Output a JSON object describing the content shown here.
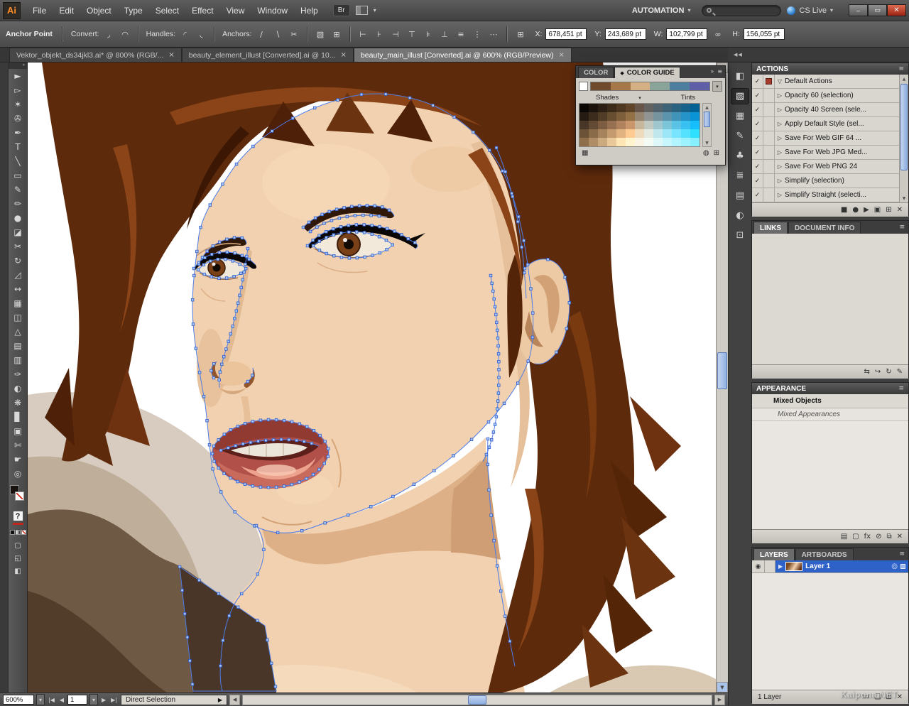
{
  "menubar": {
    "logo": "Ai",
    "items": [
      "File",
      "Edit",
      "Object",
      "Type",
      "Select",
      "Effect",
      "View",
      "Window",
      "Help"
    ],
    "bridge": "Br",
    "workspace": "AUTOMATION",
    "cs_live": "CS Live"
  },
  "window_controls": {
    "minimize": "–",
    "restore": "▭",
    "close": "✕"
  },
  "ui": {
    "caret": "▾",
    "menu": "≡",
    "close_tab": "×",
    "check": "✓",
    "tri_right": "▷",
    "tri_down": "▽",
    "dbl_left": "◀◀",
    "dbl_right": "»",
    "up": "▲",
    "down": "▼",
    "left": "◀",
    "right": "▶",
    "first": "|◀",
    "last": "▶|",
    "eye": "◉",
    "target": "◎"
  },
  "control_bar": {
    "context": "Anchor Point",
    "groups": [
      {
        "label": "Convert:",
        "icons": [
          {
            "n": "convert-to-corner-icon",
            "g": "◞"
          },
          {
            "n": "convert-to-smooth-icon",
            "g": "◠"
          }
        ]
      },
      {
        "label": "Handles:",
        "icons": [
          {
            "n": "show-handles-icon",
            "g": "◜"
          },
          {
            "n": "hide-handles-icon",
            "g": "◟"
          }
        ]
      },
      {
        "label": "Anchors:",
        "icons": [
          {
            "n": "remove-anchor-icon",
            "g": "∕"
          },
          {
            "n": "add-anchor-icon",
            "g": "∖"
          },
          {
            "n": "cut-path-icon",
            "g": "✂"
          }
        ]
      }
    ],
    "extra_icons": [
      {
        "n": "isolate-selected-icon",
        "g": "▧"
      },
      {
        "n": "measure-grid-icon",
        "g": "⊞"
      }
    ],
    "align_icons": [
      {
        "n": "align-left-icon",
        "g": "⊢"
      },
      {
        "n": "align-center-icon",
        "g": "⊦"
      },
      {
        "n": "align-right-icon",
        "g": "⊣"
      },
      {
        "n": "align-top-icon",
        "g": "⊤"
      },
      {
        "n": "align-middle-icon",
        "g": "⊧"
      },
      {
        "n": "align-bottom-icon",
        "g": "⊥"
      }
    ],
    "distribute_icons": [
      {
        "n": "distribute-vertical-icon",
        "g": "≡"
      },
      {
        "n": "distribute-horizontal-icon",
        "g": "⋮"
      },
      {
        "n": "distribute-space-icon",
        "g": "⋯"
      }
    ],
    "fields": {
      "ref_icon": "⊞",
      "x_label": "X:",
      "x_value": "678,451 pt",
      "y_label": "Y:",
      "y_value": "243,689 pt",
      "w_label": "W:",
      "w_value": "102,799 pt",
      "constrain_icon": "∞",
      "h_label": "H:",
      "h_value": "156,055 pt"
    }
  },
  "doc_tabs": [
    {
      "label": "Vektor_objekt_ds34jkl3.ai* @ 800% (RGB/...",
      "active": false
    },
    {
      "label": "beauty_element_illust [Converted].ai @ 10...",
      "active": false
    },
    {
      "label": "beauty_main_illust [Converted].ai @ 600% (RGB/Preview)",
      "active": true
    }
  ],
  "tools": [
    {
      "n": "selection-tool",
      "g": "►"
    },
    {
      "n": "direct-selection-tool",
      "g": "▻"
    },
    {
      "n": "magic-wand-tool",
      "g": "✶"
    },
    {
      "n": "lasso-tool",
      "g": "✇"
    },
    {
      "n": "pen-tool",
      "g": "✒"
    },
    {
      "n": "type-tool",
      "g": "T"
    },
    {
      "n": "line-segment-tool",
      "g": "╲"
    },
    {
      "n": "rectangle-tool",
      "g": "▭"
    },
    {
      "n": "paintbrush-tool",
      "g": "✎"
    },
    {
      "n": "pencil-tool",
      "g": "✏"
    },
    {
      "n": "blob-brush-tool",
      "g": "●"
    },
    {
      "n": "eraser-tool",
      "g": "◪"
    },
    {
      "n": "scissors-tool",
      "g": "✂"
    },
    {
      "n": "rotate-tool",
      "g": "↻"
    },
    {
      "n": "scale-tool",
      "g": "◿"
    },
    {
      "n": "width-tool",
      "g": "↔"
    },
    {
      "n": "free-transform-tool",
      "g": "▦"
    },
    {
      "n": "shape-builder-tool",
      "g": "◫"
    },
    {
      "n": "perspective-grid-tool",
      "g": "△"
    },
    {
      "n": "mesh-tool",
      "g": "▤"
    },
    {
      "n": "gradient-tool",
      "g": "▥"
    },
    {
      "n": "eyedropper-tool",
      "g": "✑"
    },
    {
      "n": "blend-tool",
      "g": "◐"
    },
    {
      "n": "symbol-sprayer-tool",
      "g": "❋"
    },
    {
      "n": "column-graph-tool",
      "g": "▊"
    },
    {
      "n": "artboard-tool",
      "g": "▣"
    },
    {
      "n": "slice-tool",
      "g": "✄"
    },
    {
      "n": "hand-tool",
      "g": "☛"
    },
    {
      "n": "zoom-tool",
      "g": "◎"
    }
  ],
  "toolbar_extra": [
    {
      "n": "draw-normal-mode-icon",
      "g": "▢"
    },
    {
      "n": "draw-behind-mode-icon",
      "g": "◱"
    },
    {
      "n": "screen-mode-icon",
      "g": "◧"
    }
  ],
  "missing_tool_glyph": "?",
  "dock_icons": [
    {
      "n": "color-panel-icon",
      "g": "◧"
    },
    {
      "n": "color-guide-panel-icon",
      "g": "▨"
    },
    {
      "n": "swatches-panel-icon",
      "g": "▦"
    },
    {
      "n": "brushes-panel-icon",
      "g": "✎"
    },
    {
      "n": "symbols-panel-icon",
      "g": "♣"
    },
    {
      "n": "stroke-panel-icon",
      "g": "≣"
    },
    {
      "n": "gradient-panel-icon",
      "g": "▤"
    },
    {
      "n": "transparency-panel-icon",
      "g": "◐"
    },
    {
      "n": "graphic-styles-panel-icon",
      "g": "⊡"
    }
  ],
  "color_panel": {
    "tab1": "COLOR",
    "tab2": "COLOR GUIDE",
    "tab2_icon": "◆",
    "shades_label": "Shades",
    "tints_label": "Tints",
    "harmony_strip": [
      "#6f4a2e",
      "#a67848",
      "#d4b084",
      "#8aa49a",
      "#4f7f9f",
      "#5f5fa8"
    ],
    "grid": [
      [
        "#0a0705",
        "#1b130c",
        "#2c1f13",
        "#3d2b1a",
        "#4e3721",
        "#5f4328",
        "#665548",
        "#646260",
        "#52626c",
        "#3e6276",
        "#2a6280",
        "#16628a",
        "#026294"
      ],
      [
        "#251b12",
        "#3b2c1d",
        "#513d27",
        "#674e31",
        "#7d5f3b",
        "#937045",
        "#948470",
        "#909492",
        "#76949e",
        "#5b94ac",
        "#4094ba",
        "#2594c8",
        "#0a94d6"
      ],
      [
        "#483726",
        "#624a34",
        "#7c5d42",
        "#967050",
        "#b0835e",
        "#ca966c",
        "#c6b69c",
        "#c0c8c0",
        "#9ec6cc",
        "#7cc4d8",
        "#5ac2e4",
        "#38c0f0",
        "#16befc"
      ],
      [
        "#6c5338",
        "#896b4a",
        "#a6835c",
        "#c39b6e",
        "#e0b380",
        "#fdcb92",
        "#eedbbe",
        "#e4eae0",
        "#c0e8ec",
        "#9ce6f8",
        "#78e4ff",
        "#54e2ff",
        "#30e0ff"
      ],
      [
        "#8f6e4c",
        "#ad8c66",
        "#cbaa80",
        "#e9c89a",
        "#ffe6b4",
        "#fff4ce",
        "#faf4e4",
        "#f4faf4",
        "#def8fa",
        "#c8f6ff",
        "#b2f4ff",
        "#9cf2ff",
        "#86f0ff"
      ]
    ],
    "bottom_icons": [
      {
        "n": "limit-colors-icon",
        "g": "▦"
      },
      {
        "n": "edit-colors-icon",
        "g": "◍"
      },
      {
        "n": "save-to-swatches-icon",
        "g": "⊞"
      }
    ]
  },
  "actions": {
    "title": "ACTIONS",
    "items": [
      {
        "label": "Default Actions",
        "set": true
      },
      {
        "label": "Opacity 60 (selection)"
      },
      {
        "label": "Opacity 40 Screen (sele..."
      },
      {
        "label": "Apply Default Style (sel..."
      },
      {
        "label": "Save For Web GIF 64 ..."
      },
      {
        "label": "Save For Web JPG Med..."
      },
      {
        "label": "Save For Web PNG 24"
      },
      {
        "label": "Simplify (selection)"
      },
      {
        "label": "Simplify Straight (selecti..."
      }
    ],
    "bottom": [
      {
        "n": "stop-icon",
        "g": "■"
      },
      {
        "n": "record-icon",
        "g": "●"
      },
      {
        "n": "play-icon",
        "g": "▶"
      },
      {
        "n": "new-set-icon",
        "g": "▣"
      },
      {
        "n": "new-action-icon",
        "g": "⊞"
      },
      {
        "n": "delete-action-icon",
        "g": "✕"
      }
    ]
  },
  "links": {
    "tab1": "LINKS",
    "tab2": "DOCUMENT INFO",
    "bottom": [
      {
        "n": "relink-icon",
        "g": "⇆"
      },
      {
        "n": "go-to-link-icon",
        "g": "↪"
      },
      {
        "n": "update-link-icon",
        "g": "↻"
      },
      {
        "n": "edit-original-icon",
        "g": "✎"
      }
    ]
  },
  "appearance": {
    "title": "APPEARANCE",
    "row1": "Mixed Objects",
    "row2": "Mixed Appearances",
    "bottom": [
      {
        "n": "new-stroke-icon",
        "g": "▤"
      },
      {
        "n": "new-fill-icon",
        "g": "▢"
      },
      {
        "n": "add-effect-icon",
        "g": "fx"
      },
      {
        "n": "clear-appearance-icon",
        "g": "⊘"
      },
      {
        "n": "duplicate-item-icon",
        "g": "⧉"
      },
      {
        "n": "delete-item-icon",
        "g": "✕"
      }
    ]
  },
  "layers": {
    "tab1": "LAYERS",
    "tab2": "ARTBOARDS",
    "layer_name": "Layer 1",
    "status": "1 Layer",
    "bottom": [
      {
        "n": "make-clip-mask-icon",
        "g": "▭"
      },
      {
        "n": "new-sublayer-icon",
        "g": "❏"
      },
      {
        "n": "new-layer-icon",
        "g": "⊞"
      },
      {
        "n": "delete-layer-icon",
        "g": "✕"
      }
    ]
  },
  "status_bar": {
    "zoom": "600%",
    "page_field": "1",
    "tool_name": "Direct Selection"
  },
  "watermark": "Kaipona.NET"
}
